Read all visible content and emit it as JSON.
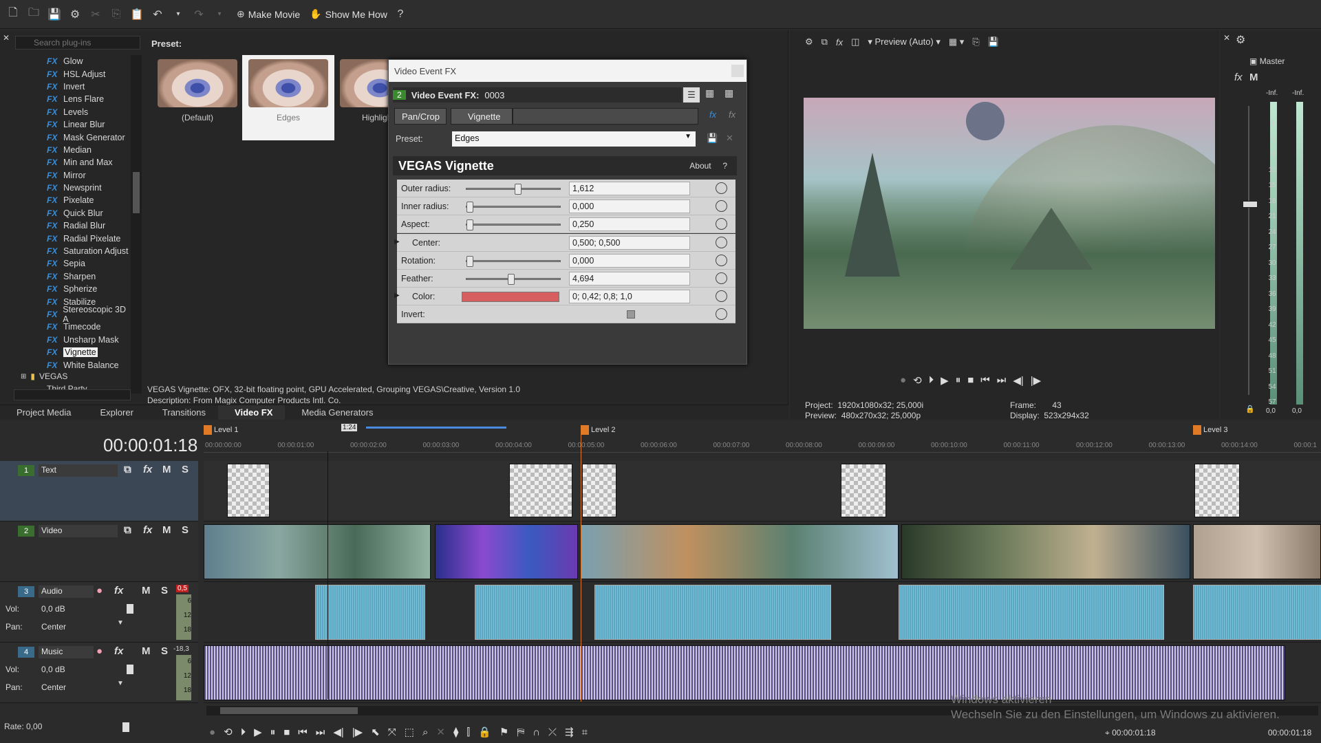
{
  "toolbar": {
    "make_movie": "Make Movie",
    "show_me_how": "Show Me How"
  },
  "plugins": {
    "search_placeholder": "Search plug-ins",
    "items": [
      "Glow",
      "HSL Adjust",
      "Invert",
      "Lens Flare",
      "Levels",
      "Linear Blur",
      "Mask Generator",
      "Median",
      "Min and Max",
      "Mirror",
      "Newsprint",
      "Pixelate",
      "Quick Blur",
      "Radial Blur",
      "Radial Pixelate",
      "Saturation Adjust",
      "Sepia",
      "Sharpen",
      "Spherize",
      "Stabilize",
      "Stereoscopic 3D A",
      "Timecode",
      "Unsharp Mask",
      "Vignette",
      "White Balance"
    ],
    "selected": "Vignette",
    "folder1": "VEGAS",
    "folder2": "Third Party"
  },
  "presets": {
    "label": "Preset:",
    "items": [
      "(Default)",
      "Edges",
      "Highligh"
    ]
  },
  "fx_status": {
    "line1": "VEGAS Vignette: OFX, 32-bit floating point, GPU Accelerated, Grouping VEGAS\\Creative, Version 1.0",
    "line2": "Description: From Magix Computer Products Intl. Co."
  },
  "tabs": [
    "Project Media",
    "Explorer",
    "Transitions",
    "Video FX",
    "Media Generators"
  ],
  "dialog": {
    "title": "Video Event FX",
    "badge": "2",
    "header_label": "Video Event FX:",
    "header_value": "0003",
    "chain1": "Pan/Crop",
    "chain2": "Vignette",
    "preset_label": "Preset:",
    "preset_value": "Edges",
    "plugin_name": "VEGAS Vignette",
    "about": "About",
    "help": "?",
    "params": [
      {
        "label": "Outer radius:",
        "value": "1,612",
        "level": 0.55
      },
      {
        "label": "Inner radius:",
        "value": "0,000",
        "level": 0.0
      },
      {
        "label": "Aspect:",
        "value": "0,250",
        "level": 0.0
      },
      {
        "label": "Center:",
        "value": "0,500; 0,500"
      },
      {
        "label": "Rotation:",
        "value": "0,000",
        "level": 0.0
      },
      {
        "label": "Feather:",
        "value": "4,694",
        "level": 0.47
      },
      {
        "label": "Color:",
        "value": "0; 0,42; 0,8; 1,0",
        "color": "#d75e5e"
      },
      {
        "label": "Invert:",
        "value": ""
      }
    ]
  },
  "preview": {
    "mode": "Preview (Auto)",
    "project_label": "Project:",
    "project": "1920x1080x32; 25,000i",
    "preview_label": "Preview:",
    "preview_val": "480x270x32; 25,000p",
    "frame_label": "Frame:",
    "frame": "43",
    "display_label": "Display:",
    "display": "523x294x32"
  },
  "master": {
    "label": "Master",
    "inf1": "-Inf.",
    "inf2": "-Inf.",
    "scale": [
      "3",
      "6",
      "9",
      "12",
      "15",
      "18",
      "21",
      "24",
      "27",
      "30",
      "33",
      "36",
      "39",
      "42",
      "45",
      "48",
      "51",
      "54",
      "57"
    ],
    "bottom1": "0,0",
    "bottom2": "0,0"
  },
  "timeline": {
    "timecode": "00:00:01:18",
    "regions": [
      "Level 1",
      "Level 2",
      "Level 3"
    ],
    "loop": "1:24",
    "ruler": [
      "00:00:00:00",
      "00:00:01:00",
      "00:00:02:00",
      "00:00:03:00",
      "00:00:04:00",
      "00:00:05:00",
      "00:00:06:00",
      "00:00:07:00",
      "00:00:08:00",
      "00:00:09:00",
      "00:00:10:00",
      "00:00:11:00",
      "00:00:12:00",
      "00:00:13:00",
      "00:00:14:00",
      "00:00:1"
    ],
    "tracks": [
      {
        "num": "1",
        "name": "Text"
      },
      {
        "num": "2",
        "name": "Video"
      },
      {
        "num": "3",
        "name": "Audio",
        "vol_label": "Vol:",
        "vol": "0,0 dB",
        "pan_label": "Pan:",
        "pan": "Center",
        "peak": "0,5"
      },
      {
        "num": "4",
        "name": "Music",
        "vol_label": "Vol:",
        "vol": "0,0 dB",
        "pan_label": "Pan:",
        "pan": "Center",
        "peak": "-18,3"
      }
    ],
    "meter_ticks": [
      "6",
      "12",
      "18"
    ],
    "rate": "Rate: 0,00",
    "status_time": "00:00:01:18",
    "status_time2": "00:00:01:18",
    "watermark1": "Windows aktivieren",
    "watermark2": "Wechseln Sie zu den Einstellungen, um Windows zu aktivieren."
  }
}
